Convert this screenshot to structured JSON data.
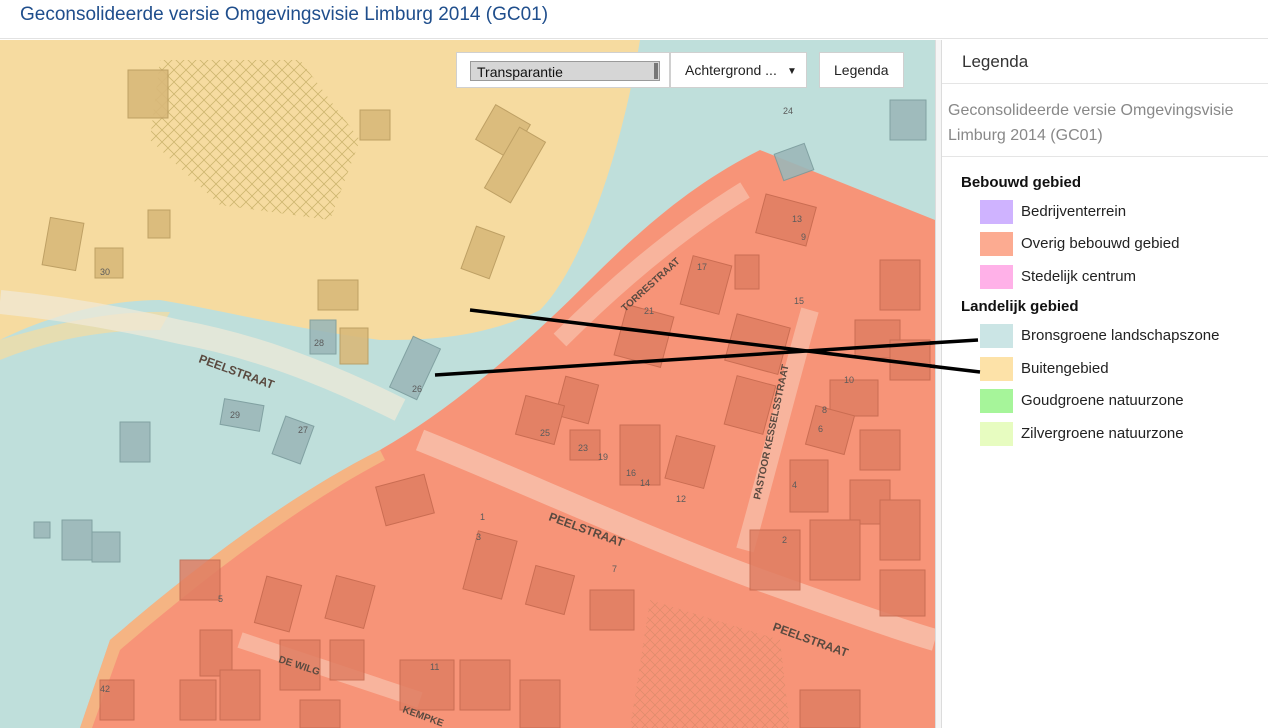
{
  "page": {
    "title": "Geconsolideerde versie Omgevingsvisie Limburg 2014 (GC01)"
  },
  "map": {
    "street_labels": [
      "PEELSTRAAT",
      "PEELSTRAAT",
      "PEELSTRAAT",
      "TORRESTRAAT",
      "PASTOOR KESSELSSTRAAT",
      "DE WILG",
      "KEMPKE"
    ],
    "house_numbers": [
      "30",
      "24",
      "28",
      "26",
      "29",
      "27",
      "21",
      "17",
      "13",
      "9",
      "15",
      "10",
      "8",
      "6",
      "4",
      "2",
      "5",
      "3",
      "1",
      "11",
      "7",
      "42",
      "25",
      "23",
      "19",
      "16",
      "14",
      "12"
    ]
  },
  "toolbar": {
    "transparency_label": "Transparantie",
    "background_label": "Achtergrond ...",
    "legend_label": "Legenda"
  },
  "legend": {
    "heading": "Legenda",
    "subtitle": "Geconsolideerde versie Omgevingsvisie Limburg 2014 (GC01)",
    "groups": [
      {
        "title": "Bebouwd gebied",
        "items": [
          {
            "label": "Bedrijventerrein",
            "color": "#cfb3ff"
          },
          {
            "label": "Overig bebouwd gebied",
            "color": "#fcab91"
          },
          {
            "label": "Stedelijk centrum",
            "color": "#ffb1e8"
          }
        ]
      },
      {
        "title": "Landelijk gebied",
        "items": [
          {
            "label": "Bronsgroene landschapszone",
            "color": "#cbe5e5"
          },
          {
            "label": "Buitengebied",
            "color": "#fde2a8"
          },
          {
            "label": "Goudgroene natuurzone",
            "color": "#a6f59a"
          },
          {
            "label": "Zilvergroene natuurzone",
            "color": "#e7fcc0"
          }
        ]
      }
    ]
  },
  "colors": {
    "title": "#1f4e8c",
    "zone_overig": "#f79478",
    "zone_buitengebied": "#f6dba0",
    "zone_bronsgroen": "#bfdfdb",
    "annotation_line": "#000000"
  }
}
